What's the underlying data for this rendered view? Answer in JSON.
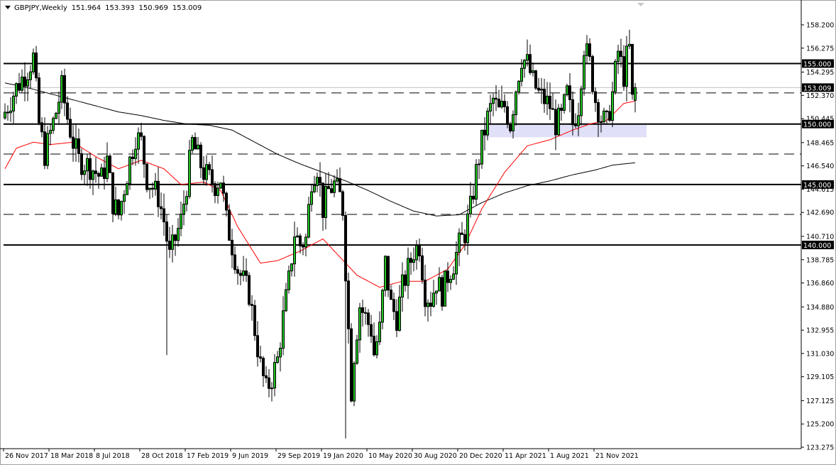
{
  "header": {
    "symbol_timeframe": "GBPJPY,Weekly",
    "open": "151.964",
    "high": "153.393",
    "low": "150.969",
    "close": "153.009"
  },
  "colors": {
    "bull_body": "#22c322",
    "bear_body": "#000000",
    "ma_fast": "#ff0000",
    "ma_slow": "#000000",
    "zone": "#e0e0f8",
    "current_line": "#c0c0c0"
  },
  "chart_data": {
    "type": "candlestick",
    "symbol": "GBPJPY",
    "timeframe": "Weekly",
    "y_range": [
      123.275,
      158.2
    ],
    "y_ticks": [
      "158.200",
      "156.275",
      "154.295",
      "152.370",
      "150.445",
      "148.465",
      "146.540",
      "144.615",
      "142.690",
      "140.710",
      "138.785",
      "136.860",
      "134.880",
      "132.955",
      "131.030",
      "129.105",
      "127.125",
      "125.200",
      "123.275"
    ],
    "y_tick_values": [
      158.2,
      156.275,
      154.295,
      152.37,
      150.445,
      148.465,
      146.54,
      144.615,
      142.69,
      140.71,
      138.785,
      136.86,
      134.88,
      132.955,
      131.03,
      129.105,
      127.125,
      125.2,
      123.275
    ],
    "x_labels": [
      "26 Nov 2017",
      "18 Mar 2018",
      "8 Jul 2018",
      "28 Oct 2018",
      "17 Feb 2019",
      "9 Jun 2019",
      "29 Sep 2019",
      "19 Jan 2020",
      "10 May 2020",
      "30 Aug 2020",
      "20 Dec 2020",
      "11 Apr 2021",
      "1 Aug 2021",
      "21 Nov 2021"
    ],
    "x_label_week_index": [
      0,
      16,
      32,
      48,
      64,
      80,
      96,
      112,
      128,
      144,
      160,
      176,
      192,
      208
    ],
    "total_weeks": 223,
    "close_path_week_price": [
      [
        0,
        151
      ],
      [
        4,
        153
      ],
      [
        8,
        154.5
      ],
      [
        10,
        155.5
      ],
      [
        12,
        150
      ],
      [
        14,
        147.5
      ],
      [
        18,
        151
      ],
      [
        20,
        153
      ],
      [
        22,
        150.5
      ],
      [
        24,
        148.5
      ],
      [
        26,
        147
      ],
      [
        30,
        146.5
      ],
      [
        34,
        145.5
      ],
      [
        36,
        147
      ],
      [
        38,
        143.5
      ],
      [
        40,
        142.5
      ],
      [
        44,
        147
      ],
      [
        46,
        149
      ],
      [
        48,
        148.5
      ],
      [
        50,
        145.5
      ],
      [
        54,
        144
      ],
      [
        56,
        142
      ],
      [
        58,
        139
      ],
      [
        60,
        140.5
      ],
      [
        62,
        142
      ],
      [
        64,
        145
      ],
      [
        66,
        148.5
      ],
      [
        70,
        146
      ],
      [
        74,
        145
      ],
      [
        76,
        145.5
      ],
      [
        78,
        142
      ],
      [
        80,
        140
      ],
      [
        82,
        138
      ],
      [
        84,
        137
      ],
      [
        86,
        136
      ],
      [
        88,
        133
      ],
      [
        90,
        130
      ],
      [
        92,
        128
      ],
      [
        94,
        129
      ],
      [
        96,
        130.5
      ],
      [
        98,
        134
      ],
      [
        100,
        137
      ],
      [
        102,
        141
      ],
      [
        104,
        140
      ],
      [
        106,
        140.5
      ],
      [
        108,
        145.5
      ],
      [
        110,
        146.5
      ],
      [
        112,
        143
      ],
      [
        114,
        144.5
      ],
      [
        116,
        145
      ],
      [
        118,
        144
      ],
      [
        119,
        143
      ],
      [
        120,
        138
      ],
      [
        121,
        133
      ],
      [
        122,
        128
      ],
      [
        123,
        131
      ],
      [
        125,
        135
      ],
      [
        127,
        134
      ],
      [
        129,
        133
      ],
      [
        130,
        131
      ],
      [
        132,
        133
      ],
      [
        134,
        138.5
      ],
      [
        136,
        135
      ],
      [
        138,
        134
      ],
      [
        140,
        136.5
      ],
      [
        142,
        138
      ],
      [
        144,
        139.5
      ],
      [
        146,
        140
      ],
      [
        148,
        136
      ],
      [
        150,
        135.5
      ],
      [
        152,
        137
      ],
      [
        154,
        136
      ],
      [
        156,
        137.5
      ],
      [
        158,
        138.5
      ],
      [
        160,
        140
      ],
      [
        162,
        141
      ],
      [
        164,
        143
      ],
      [
        166,
        146
      ],
      [
        168,
        148.5
      ],
      [
        170,
        150.5
      ],
      [
        172,
        152
      ],
      [
        174,
        151
      ],
      [
        176,
        151.5
      ],
      [
        178,
        150
      ],
      [
        180,
        153
      ],
      [
        182,
        155.5
      ],
      [
        184,
        155
      ],
      [
        186,
        153.5
      ],
      [
        188,
        152.5
      ],
      [
        190,
        152
      ],
      [
        192,
        151.5
      ],
      [
        194,
        150
      ],
      [
        196,
        150.5
      ],
      [
        198,
        152.5
      ],
      [
        200,
        150
      ],
      [
        202,
        151.5
      ],
      [
        204,
        156.5
      ],
      [
        206,
        155
      ],
      [
        208,
        152
      ],
      [
        210,
        150.5
      ],
      [
        212,
        150
      ],
      [
        214,
        152.5
      ],
      [
        216,
        156
      ],
      [
        218,
        154
      ],
      [
        219,
        155.5
      ],
      [
        220,
        156.2
      ],
      [
        221,
        151.9
      ],
      [
        222,
        153.009
      ]
    ],
    "ma_fast_week_price": [
      [
        0,
        146.3
      ],
      [
        4,
        148
      ],
      [
        10,
        148.5
      ],
      [
        16,
        148.3
      ],
      [
        24,
        148.5
      ],
      [
        32,
        147.3
      ],
      [
        40,
        146.3
      ],
      [
        48,
        147
      ],
      [
        56,
        146.3
      ],
      [
        62,
        145
      ],
      [
        70,
        145.2
      ],
      [
        76,
        144.5
      ],
      [
        82,
        141.5
      ],
      [
        90,
        138.5
      ],
      [
        96,
        138.7
      ],
      [
        104,
        139.5
      ],
      [
        112,
        140.5
      ],
      [
        118,
        139
      ],
      [
        124,
        137.5
      ],
      [
        132,
        136.5
      ],
      [
        140,
        137
      ],
      [
        148,
        137
      ],
      [
        156,
        138
      ],
      [
        162,
        140
      ],
      [
        168,
        143
      ],
      [
        176,
        146
      ],
      [
        184,
        148.2
      ],
      [
        192,
        148.7
      ],
      [
        200,
        149.5
      ],
      [
        206,
        150
      ],
      [
        212,
        150.3
      ],
      [
        218,
        151.7
      ],
      [
        222,
        151.9
      ]
    ],
    "ma_slow_week_price": [
      [
        0,
        153.4
      ],
      [
        8,
        153
      ],
      [
        16,
        152.5
      ],
      [
        24,
        152
      ],
      [
        32,
        151.5
      ],
      [
        40,
        151
      ],
      [
        48,
        150.7
      ],
      [
        56,
        150.3
      ],
      [
        64,
        150
      ],
      [
        72,
        149.9
      ],
      [
        80,
        149.5
      ],
      [
        88,
        148.5
      ],
      [
        96,
        147.5
      ],
      [
        104,
        146.7
      ],
      [
        112,
        146
      ],
      [
        120,
        145.3
      ],
      [
        128,
        144.5
      ],
      [
        136,
        143.6
      ],
      [
        144,
        142.8
      ],
      [
        152,
        142.4
      ],
      [
        160,
        142.5
      ],
      [
        168,
        143.5
      ],
      [
        176,
        144.3
      ],
      [
        184,
        144.9
      ],
      [
        192,
        145.3
      ],
      [
        200,
        145.8
      ],
      [
        208,
        146.2
      ],
      [
        214,
        146.6
      ],
      [
        222,
        146.8
      ]
    ],
    "solid_levels": [
      155.0,
      150.0,
      145.0,
      140.0
    ],
    "solid_level_labels": [
      "155.000",
      "150.000",
      "145.000",
      "140.000"
    ],
    "dashed_levels": [
      152.57,
      147.52,
      142.53
    ],
    "current_price": 153.009,
    "current_price_label": "153.009",
    "support_zone": {
      "from_week": 169,
      "to_week": 226,
      "top": 150.0,
      "bottom": 148.9
    }
  }
}
